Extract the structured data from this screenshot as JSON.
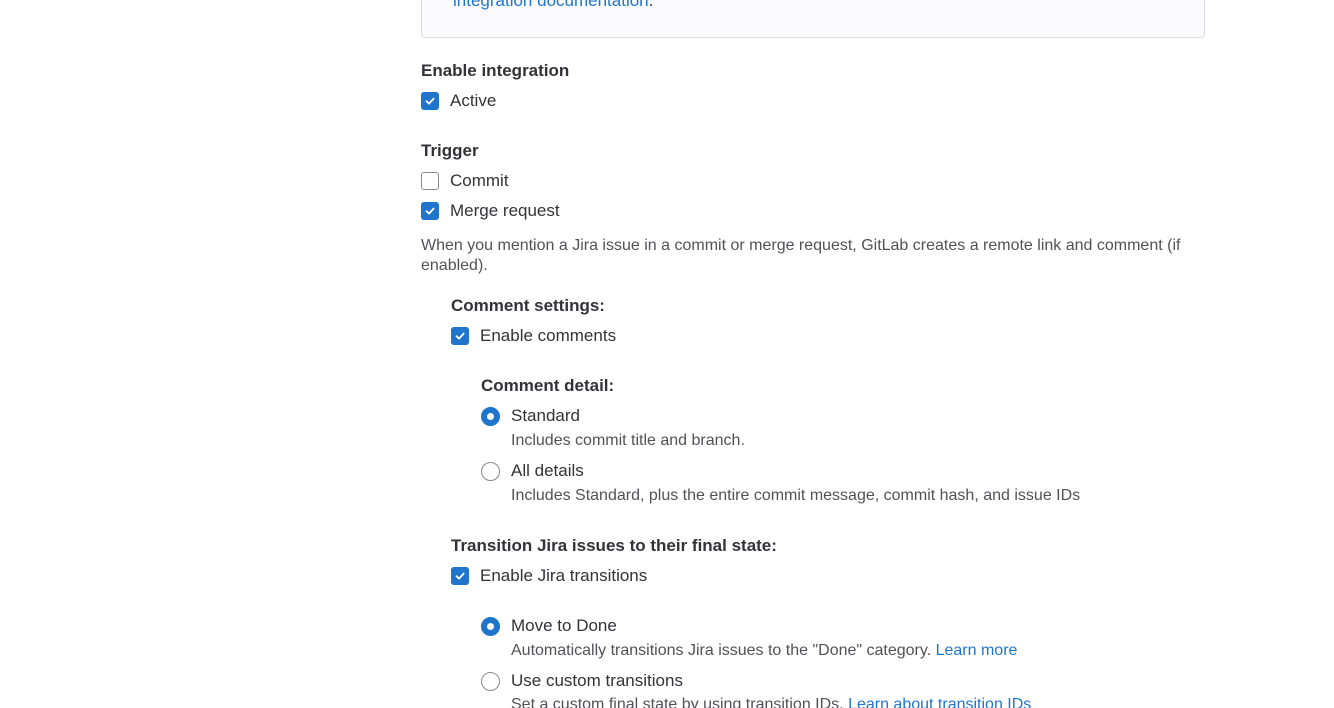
{
  "info_box": {
    "link_text": "integration documentation",
    "suffix": "."
  },
  "enable_integration": {
    "heading": "Enable integration",
    "active": {
      "label": "Active",
      "checked": true
    }
  },
  "trigger": {
    "heading": "Trigger",
    "commit": {
      "label": "Commit",
      "checked": false
    },
    "merge_request": {
      "label": "Merge request",
      "checked": true
    },
    "help": "When you mention a Jira issue in a commit or merge request, GitLab creates a remote link and comment (if enabled)."
  },
  "comment_settings": {
    "heading": "Comment settings:",
    "enable_comments": {
      "label": "Enable comments",
      "checked": true
    },
    "detail_heading": "Comment detail:",
    "standard": {
      "label": "Standard",
      "help": "Includes commit title and branch.",
      "selected": true
    },
    "all_details": {
      "label": "All details",
      "help": "Includes Standard, plus the entire commit message, commit hash, and issue IDs",
      "selected": false
    }
  },
  "transitions": {
    "heading": "Transition Jira issues to their final state:",
    "enable_transitions": {
      "label": "Enable Jira transitions",
      "checked": true
    },
    "move_to_done": {
      "label": "Move to Done",
      "help": "Automatically transitions Jira issues to the \"Done\" category.",
      "link": "Learn more",
      "selected": true
    },
    "custom": {
      "label": "Use custom transitions",
      "help": "Set a custom final state by using transition IDs.",
      "link": "Learn about transition IDs",
      "selected": false
    }
  },
  "colors": {
    "accent": "#1f75cb",
    "text": "#333238",
    "muted": "#535158",
    "border": "#89888d"
  }
}
